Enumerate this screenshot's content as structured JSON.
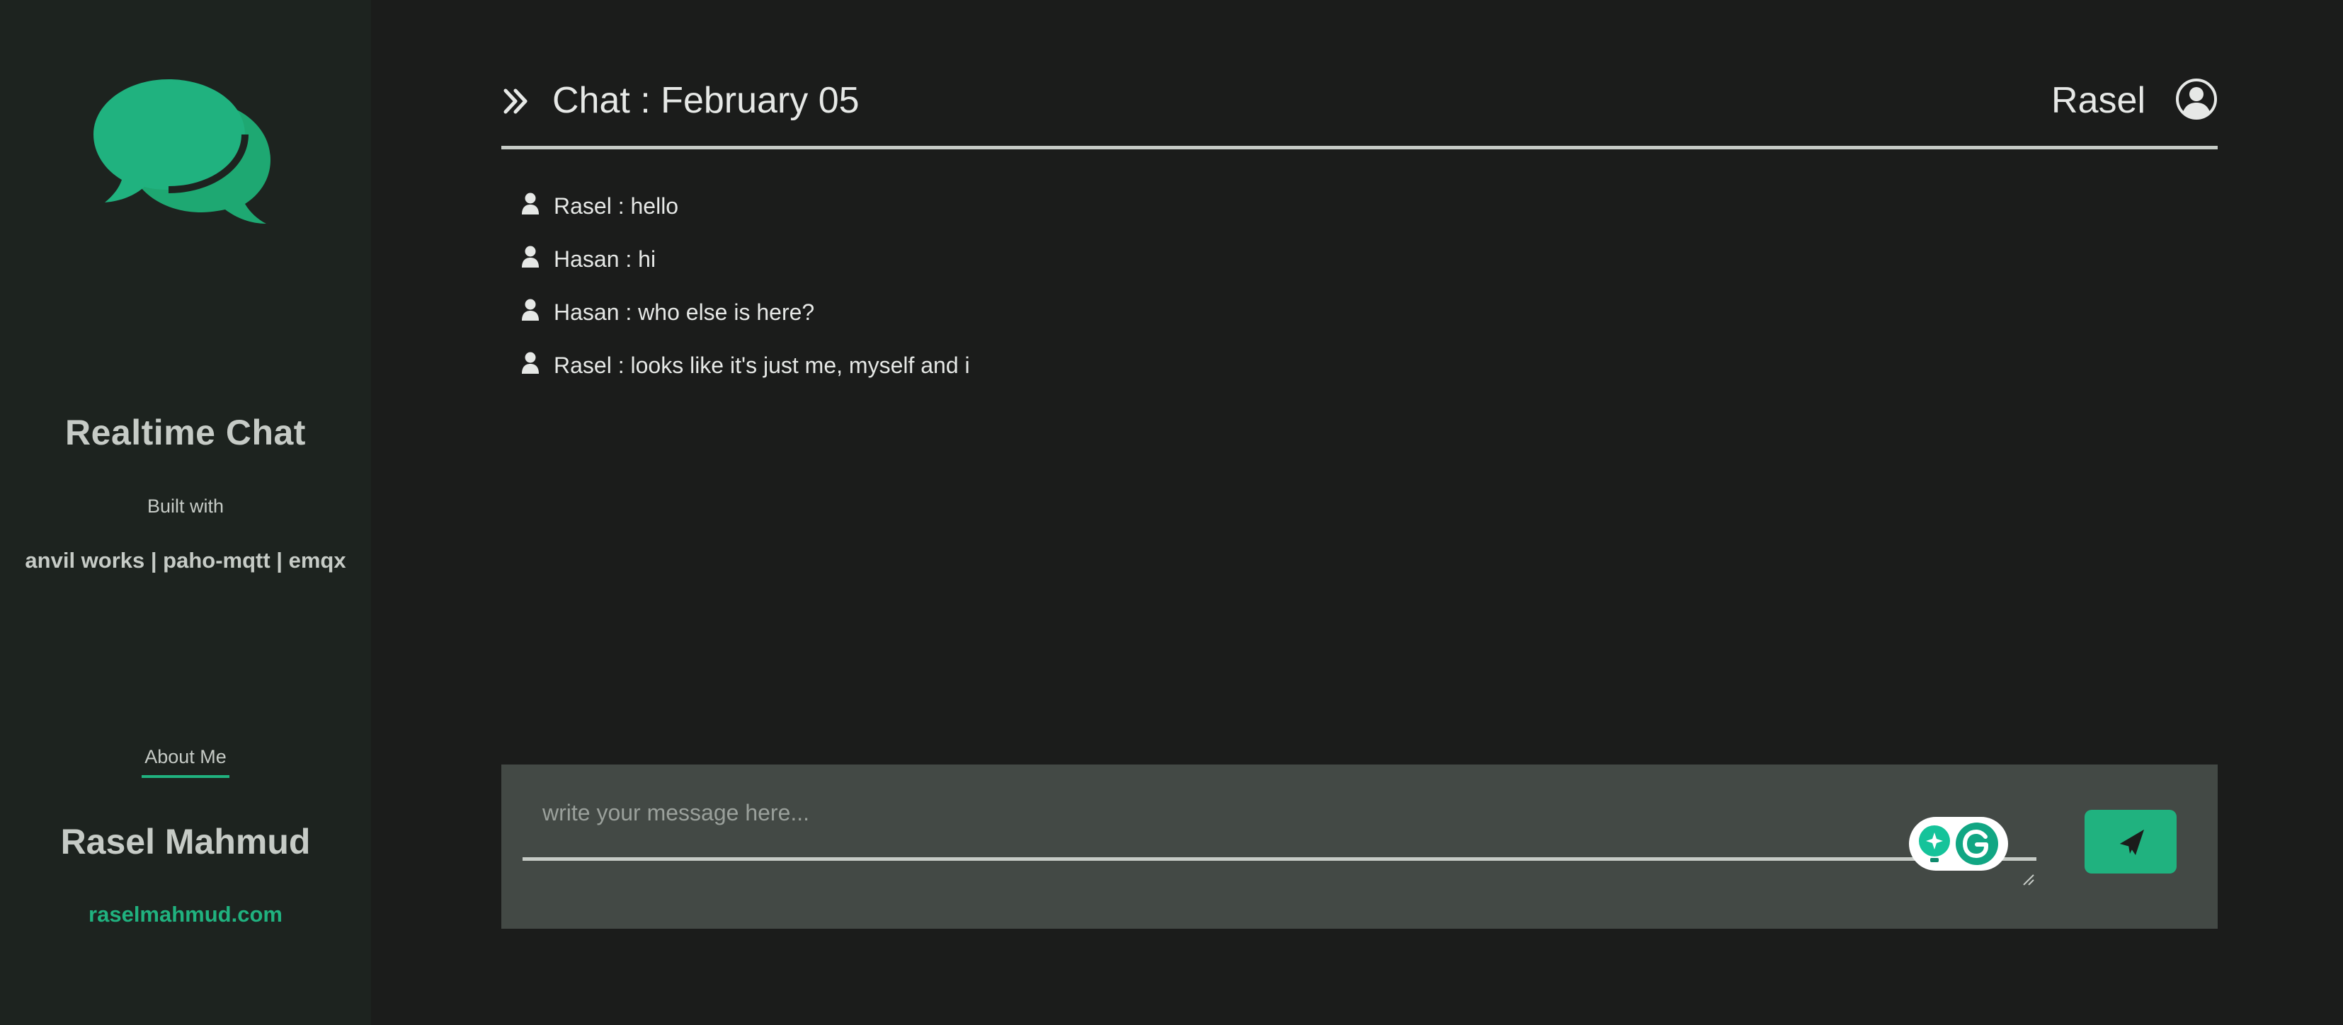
{
  "sidebar": {
    "app_title": "Realtime Chat",
    "built_with_label": "Built with",
    "tech_stack": "anvil works | paho-mqtt | emqx",
    "about_link": "About Me",
    "author_name": "Rasel Mahmud",
    "author_site": "raselmahmud.com",
    "logo_icon": "chat-bubbles-icon"
  },
  "header": {
    "title": "Chat : February 05",
    "user_name": "Rasel",
    "expand_icon": "double-chevron-right-icon",
    "user_icon": "user-circle-icon"
  },
  "messages": [
    {
      "text": "Rasel : hello"
    },
    {
      "text": "Hasan : hi"
    },
    {
      "text": "Hasan : who else is here?"
    },
    {
      "text": "Rasel : looks like it's just me, myself and i"
    }
  ],
  "composer": {
    "placeholder": "write your message here...",
    "value": "",
    "send_icon": "paper-plane-icon",
    "assist_icons": [
      "lightbulb-icon",
      "grammarly-icon"
    ]
  },
  "colors": {
    "background": "#1b1c1b",
    "sidebar": "#1d231f",
    "accent": "#20b27f",
    "text": "#e6e8e6",
    "muted": "#c6cbc6",
    "composer": "#434945"
  }
}
